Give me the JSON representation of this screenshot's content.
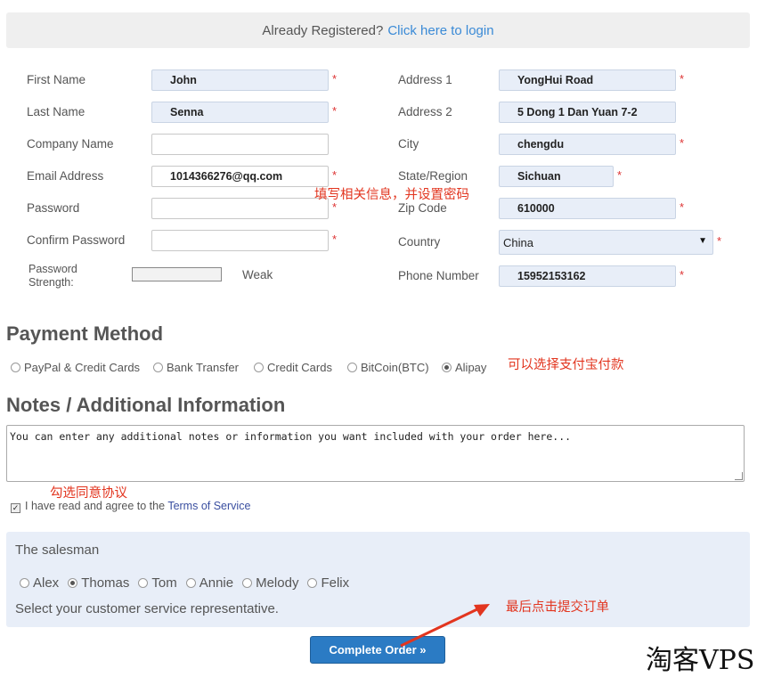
{
  "banner": {
    "text": "Already Registered?",
    "link": "Click here to login"
  },
  "left_form": [
    {
      "label": "First Name",
      "value": "John",
      "required": "*"
    },
    {
      "label": "Last Name",
      "value": "Senna",
      "required": "*"
    },
    {
      "label": "Company Name",
      "value": "",
      "required": ""
    },
    {
      "label": "Email Address",
      "value": "1014366276@qq.com",
      "required": "*"
    },
    {
      "label": "Password",
      "value": "",
      "required": "*"
    },
    {
      "label": "Confirm Password",
      "value": "",
      "required": "*"
    }
  ],
  "strength": {
    "label_line1": "Password",
    "label_line2": "Strength:",
    "value": "Weak"
  },
  "right_form": [
    {
      "label": "Address 1",
      "value": "YongHui Road",
      "required": "*"
    },
    {
      "label": "Address 2",
      "value": "5 Dong 1 Dan Yuan 7-2",
      "required": ""
    },
    {
      "label": "City",
      "value": "chengdu",
      "required": "*"
    },
    {
      "label": "State/Region",
      "value": "Sichuan",
      "required": "*"
    },
    {
      "label": "Zip Code",
      "value": "610000",
      "required": "*"
    },
    {
      "label": "Country",
      "value": "China",
      "required": "*"
    },
    {
      "label": "Phone Number",
      "value": "15952153162",
      "required": "*"
    }
  ],
  "payment": {
    "title": "Payment Method",
    "options": [
      "PayPal & Credit Cards",
      "Bank Transfer",
      "Credit Cards",
      "BitCoin(BTC)",
      "Alipay"
    ],
    "selected": "Alipay"
  },
  "notes": {
    "title": "Notes / Additional Information",
    "placeholder": "You can enter any additional notes or information you want included with your order here..."
  },
  "tos": {
    "text": "I have read and agree to the",
    "link": "Terms of Service"
  },
  "salesman": {
    "title": "The salesman",
    "options": [
      "Alex",
      "Thomas",
      "Tom",
      "Annie",
      "Melody",
      "Felix"
    ],
    "selected": "Thomas",
    "hint": "Select your customer service representative."
  },
  "submit_label": "Complete Order »",
  "annotations": {
    "fill_info": "填写相关信息，并设置密码",
    "alipay": "可以选择支付宝付款",
    "agree": "勾选同意协议",
    "submit": "最后点击提交订单"
  },
  "watermark": "淘客VPS",
  "colors": {
    "link": "#3a8ad6",
    "annotation": "#e2351f",
    "button": "#2b7bc4",
    "filled_input": "#e8eef8"
  }
}
